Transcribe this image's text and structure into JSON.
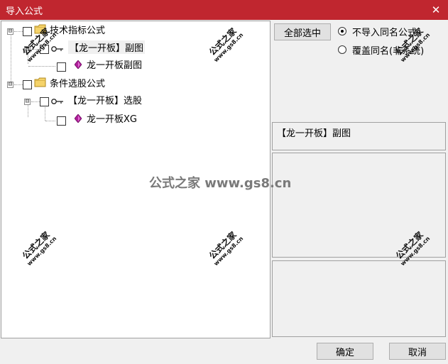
{
  "window": {
    "title": "导入公式",
    "close_glyph": "✕"
  },
  "tree": {
    "nodes": [
      {
        "label": "技术指标公式"
      },
      {
        "label": "【龙一开板】副图"
      },
      {
        "label": "龙一开板副图"
      },
      {
        "label": "条件选股公式"
      },
      {
        "label": "【龙一开板】选股"
      },
      {
        "label": "龙一开板XG"
      }
    ]
  },
  "buttons": {
    "select_all": "全部选中",
    "ok": "确定",
    "cancel": "取消"
  },
  "options": [
    {
      "label": "不导入同名公式",
      "checked": true
    },
    {
      "label": "覆盖同名(非系统)",
      "checked": false
    }
  ],
  "info": {
    "formula_name": "【龙一开板】副图"
  },
  "watermark": {
    "center": "公式之家 www.gs8.cn",
    "brand": "公式之家",
    "url": "www.gs8.cn"
  },
  "icons": {
    "folder": "folder-icon",
    "key": "key-icon",
    "formula": "gem-icon",
    "expand": "⊟"
  },
  "colors": {
    "title_bar": "#c0262f",
    "folder": "#f5d36a",
    "gem": "#b0209a"
  }
}
